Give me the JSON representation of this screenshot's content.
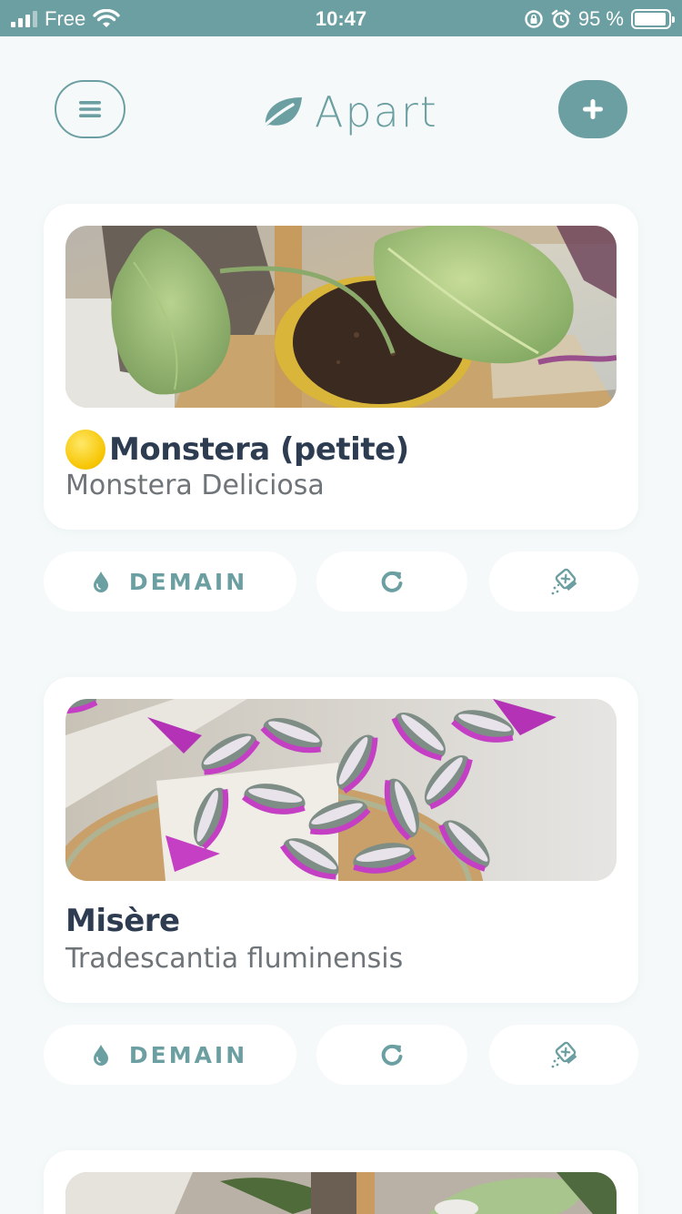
{
  "status_bar": {
    "carrier": "Free",
    "time": "10:47",
    "battery_percent": "95 %",
    "battery_level": 0.95,
    "icons": [
      "signal-icon",
      "wifi-icon",
      "rotation-lock-icon",
      "alarm-icon",
      "battery-icon"
    ]
  },
  "header": {
    "app_name": "Apart",
    "menu_icon": "menu-icon",
    "add_icon": "plus-icon",
    "logo_icon": "leaf-icon"
  },
  "colors": {
    "accent": "#6c9fa1",
    "background": "#f5f9fa",
    "card": "#ffffff",
    "title": "#2e3c52",
    "subtitle": "#6f7478",
    "status_yellow": "#f6c400"
  },
  "plants": [
    {
      "status_emoji": "🟡",
      "name": "Monstera (petite)",
      "species": "Monstera Deliciosa",
      "water_label": "DEMAIN",
      "actions": [
        "water-drop-icon",
        "refresh-icon",
        "fertilizer-icon"
      ]
    },
    {
      "name": "Misère",
      "species": "Tradescantia fluminensis",
      "water_label": "DEMAIN",
      "actions": [
        "water-drop-icon",
        "refresh-icon",
        "fertilizer-icon"
      ]
    }
  ]
}
